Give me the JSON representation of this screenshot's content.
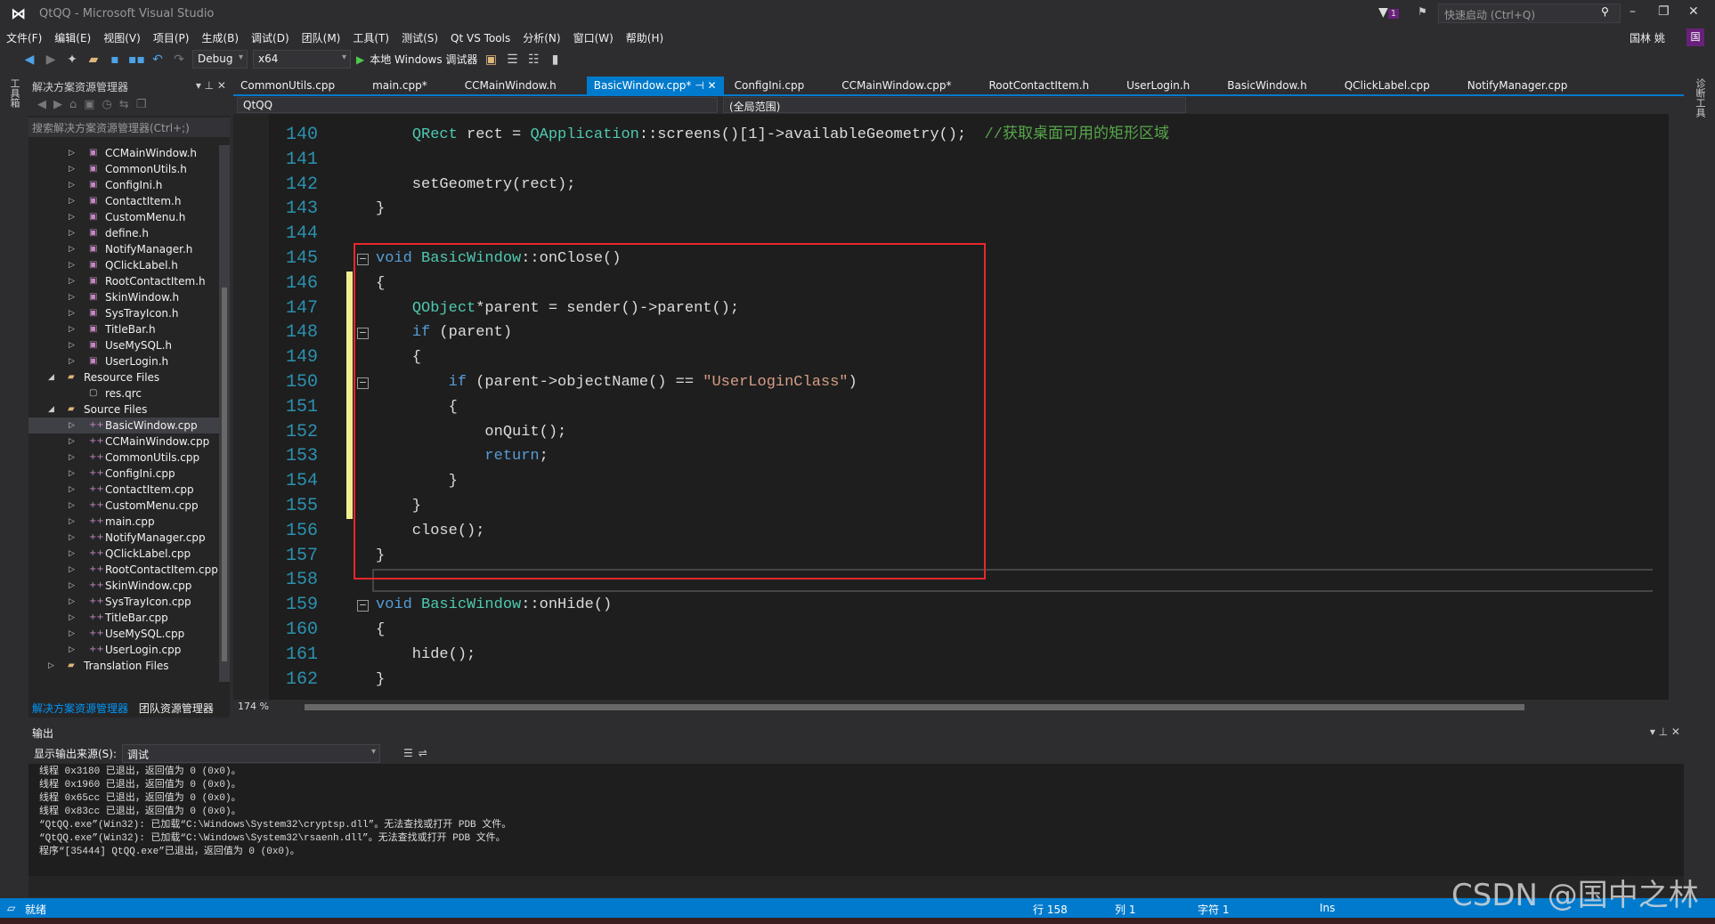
{
  "window": {
    "title": "QtQQ - Microsoft Visual Studio",
    "quick_launch_placeholder": "快速启动 (Ctrl+Q)",
    "notifications": "1",
    "user": "国林 姚",
    "avatar": "国"
  },
  "menu": [
    "文件(F)",
    "编辑(E)",
    "视图(V)",
    "项目(P)",
    "生成(B)",
    "调试(D)",
    "团队(M)",
    "工具(T)",
    "测试(S)",
    "Qt VS Tools",
    "分析(N)",
    "窗口(W)",
    "帮助(H)"
  ],
  "toolbar": {
    "config": "Debug",
    "platform": "x64",
    "run_label": "本地 Windows 调试器"
  },
  "left_strip": "工具箱",
  "right_strip": "诊断工具",
  "solution_explorer": {
    "title": "解决方案资源管理器",
    "search_placeholder": "搜索解决方案资源管理器(Ctrl+;)",
    "items": [
      {
        "label": "CCMainWindow.h",
        "kind": "h",
        "level": 2
      },
      {
        "label": "CommonUtils.h",
        "kind": "h",
        "level": 2
      },
      {
        "label": "ConfigIni.h",
        "kind": "h",
        "level": 2
      },
      {
        "label": "ContactItem.h",
        "kind": "h",
        "level": 2
      },
      {
        "label": "CustomMenu.h",
        "kind": "h",
        "level": 2
      },
      {
        "label": "define.h",
        "kind": "h",
        "level": 2
      },
      {
        "label": "NotifyManager.h",
        "kind": "h",
        "level": 2
      },
      {
        "label": "QClickLabel.h",
        "kind": "h",
        "level": 2
      },
      {
        "label": "RootContactItem.h",
        "kind": "h",
        "level": 2
      },
      {
        "label": "SkinWindow.h",
        "kind": "h",
        "level": 2
      },
      {
        "label": "SysTrayIcon.h",
        "kind": "h",
        "level": 2
      },
      {
        "label": "TitleBar.h",
        "kind": "h",
        "level": 2
      },
      {
        "label": "UseMySQL.h",
        "kind": "h",
        "level": 2
      },
      {
        "label": "UserLogin.h",
        "kind": "h",
        "level": 2
      },
      {
        "label": "Resource Files",
        "kind": "folder",
        "level": 1,
        "expanded": true
      },
      {
        "label": "res.qrc",
        "kind": "file",
        "level": 2
      },
      {
        "label": "Source Files",
        "kind": "folder",
        "level": 1,
        "expanded": true
      },
      {
        "label": "BasicWindow.cpp",
        "kind": "cpp",
        "level": 2,
        "selected": true
      },
      {
        "label": "CCMainWindow.cpp",
        "kind": "cpp",
        "level": 2
      },
      {
        "label": "CommonUtils.cpp",
        "kind": "cpp",
        "level": 2
      },
      {
        "label": "ConfigIni.cpp",
        "kind": "cpp",
        "level": 2
      },
      {
        "label": "ContactItem.cpp",
        "kind": "cpp",
        "level": 2
      },
      {
        "label": "CustomMenu.cpp",
        "kind": "cpp",
        "level": 2
      },
      {
        "label": "main.cpp",
        "kind": "cpp",
        "level": 2
      },
      {
        "label": "NotifyManager.cpp",
        "kind": "cpp",
        "level": 2
      },
      {
        "label": "QClickLabel.cpp",
        "kind": "cpp",
        "level": 2
      },
      {
        "label": "RootContactItem.cpp",
        "kind": "cpp",
        "level": 2
      },
      {
        "label": "SkinWindow.cpp",
        "kind": "cpp",
        "level": 2
      },
      {
        "label": "SysTrayIcon.cpp",
        "kind": "cpp",
        "level": 2
      },
      {
        "label": "TitleBar.cpp",
        "kind": "cpp",
        "level": 2
      },
      {
        "label": "UseMySQL.cpp",
        "kind": "cpp",
        "level": 2
      },
      {
        "label": "UserLogin.cpp",
        "kind": "cpp",
        "level": 2
      },
      {
        "label": "Translation Files",
        "kind": "folder",
        "level": 1,
        "expanded": false
      }
    ],
    "footer_tabs": [
      "解决方案资源管理器",
      "团队资源管理器"
    ]
  },
  "tabs": [
    {
      "label": "CommonUtils.cpp"
    },
    {
      "label": "main.cpp*"
    },
    {
      "label": "CCMainWindow.h"
    },
    {
      "label": "BasicWindow.cpp*",
      "active": true
    },
    {
      "label": "ConfigIni.cpp"
    },
    {
      "label": "CCMainWindow.cpp*"
    },
    {
      "label": "RootContactItem.h"
    },
    {
      "label": "UserLogin.h"
    },
    {
      "label": "BasicWindow.h"
    },
    {
      "label": "QClickLabel.cpp"
    },
    {
      "label": "NotifyManager.cpp"
    }
  ],
  "navbar": {
    "project": "QtQQ",
    "scope": "(全局范围)"
  },
  "editor": {
    "zoom": "174 %",
    "current_line": 158,
    "lines": [
      {
        "n": 140,
        "t": [
          [
            "",
            "    "
          ],
          [
            "ty",
            "QRect"
          ],
          [
            "",
            " rect = "
          ],
          [
            "ty",
            "QApplication"
          ],
          [
            "",
            "::screens()[1]->availableGeometry();  "
          ],
          [
            "cm",
            "//获取桌面可用的矩形区域"
          ]
        ]
      },
      {
        "n": 141,
        "t": []
      },
      {
        "n": 142,
        "t": [
          [
            "",
            "    setGeometry(rect);"
          ]
        ]
      },
      {
        "n": 143,
        "t": [
          [
            "",
            "}"
          ]
        ]
      },
      {
        "n": 144,
        "t": []
      },
      {
        "n": 145,
        "t": [
          [
            "kw",
            "void"
          ],
          [
            "",
            " "
          ],
          [
            "ty",
            "BasicWindow"
          ],
          [
            "",
            "::onClose()"
          ]
        ],
        "fold": true
      },
      {
        "n": 146,
        "t": [
          [
            "",
            "{"
          ]
        ],
        "changed": true
      },
      {
        "n": 147,
        "t": [
          [
            "",
            "    "
          ],
          [
            "ty",
            "QObject"
          ],
          [
            "",
            "*parent = sender()->parent();"
          ]
        ],
        "changed": true
      },
      {
        "n": 148,
        "t": [
          [
            "",
            "    "
          ],
          [
            "kw",
            "if"
          ],
          [
            "",
            " (parent)"
          ]
        ],
        "changed": true,
        "fold": true
      },
      {
        "n": 149,
        "t": [
          [
            "",
            "    {"
          ]
        ],
        "changed": true
      },
      {
        "n": 150,
        "t": [
          [
            "",
            "        "
          ],
          [
            "kw",
            "if"
          ],
          [
            "",
            " (parent->objectName() == "
          ],
          [
            "st",
            "\"UserLoginClass\""
          ],
          [
            "",
            ")"
          ]
        ],
        "changed": true,
        "fold": true
      },
      {
        "n": 151,
        "t": [
          [
            "",
            "        {"
          ]
        ],
        "changed": true
      },
      {
        "n": 152,
        "t": [
          [
            "",
            "            onQuit();"
          ]
        ],
        "changed": true
      },
      {
        "n": 153,
        "t": [
          [
            "",
            "            "
          ],
          [
            "kw",
            "return"
          ],
          [
            "",
            ";"
          ]
        ],
        "changed": true
      },
      {
        "n": 154,
        "t": [
          [
            "",
            "        }"
          ]
        ],
        "changed": true
      },
      {
        "n": 155,
        "t": [
          [
            "",
            "    }"
          ]
        ],
        "changed": true
      },
      {
        "n": 156,
        "t": [
          [
            "",
            "    close();"
          ]
        ]
      },
      {
        "n": 157,
        "t": [
          [
            "",
            "}"
          ]
        ]
      },
      {
        "n": 158,
        "t": []
      },
      {
        "n": 159,
        "t": [
          [
            "kw",
            "void"
          ],
          [
            "",
            " "
          ],
          [
            "ty",
            "BasicWindow"
          ],
          [
            "",
            "::onHide()"
          ]
        ],
        "fold": true
      },
      {
        "n": 160,
        "t": [
          [
            "",
            "{"
          ]
        ]
      },
      {
        "n": 161,
        "t": [
          [
            "",
            "    hide();"
          ]
        ]
      },
      {
        "n": 162,
        "t": [
          [
            "",
            "}"
          ]
        ]
      }
    ]
  },
  "output": {
    "title": "输出",
    "source_label": "显示输出来源(S):",
    "source_value": "调试",
    "lines": [
      "线程 0x3180 已退出，返回值为 0 (0x0)。",
      "线程 0x1960 已退出，返回值为 0 (0x0)。",
      "线程 0x65cc 已退出，返回值为 0 (0x0)。",
      "线程 0x83cc 已退出，返回值为 0 (0x0)。",
      "“QtQQ.exe”(Win32): 已加载“C:\\Windows\\System32\\cryptsp.dll”。无法查找或打开 PDB 文件。",
      "“QtQQ.exe”(Win32): 已加载“C:\\Windows\\System32\\rsaenh.dll”。无法查找或打开 PDB 文件。",
      "程序“[35444] QtQQ.exe”已退出，返回值为 0 (0x0)。"
    ]
  },
  "status": {
    "ready": "就绪",
    "line": "行 158",
    "col": "列 1",
    "char": "字符 1",
    "mode": "Ins"
  },
  "watermark": "CSDN @国中之林"
}
